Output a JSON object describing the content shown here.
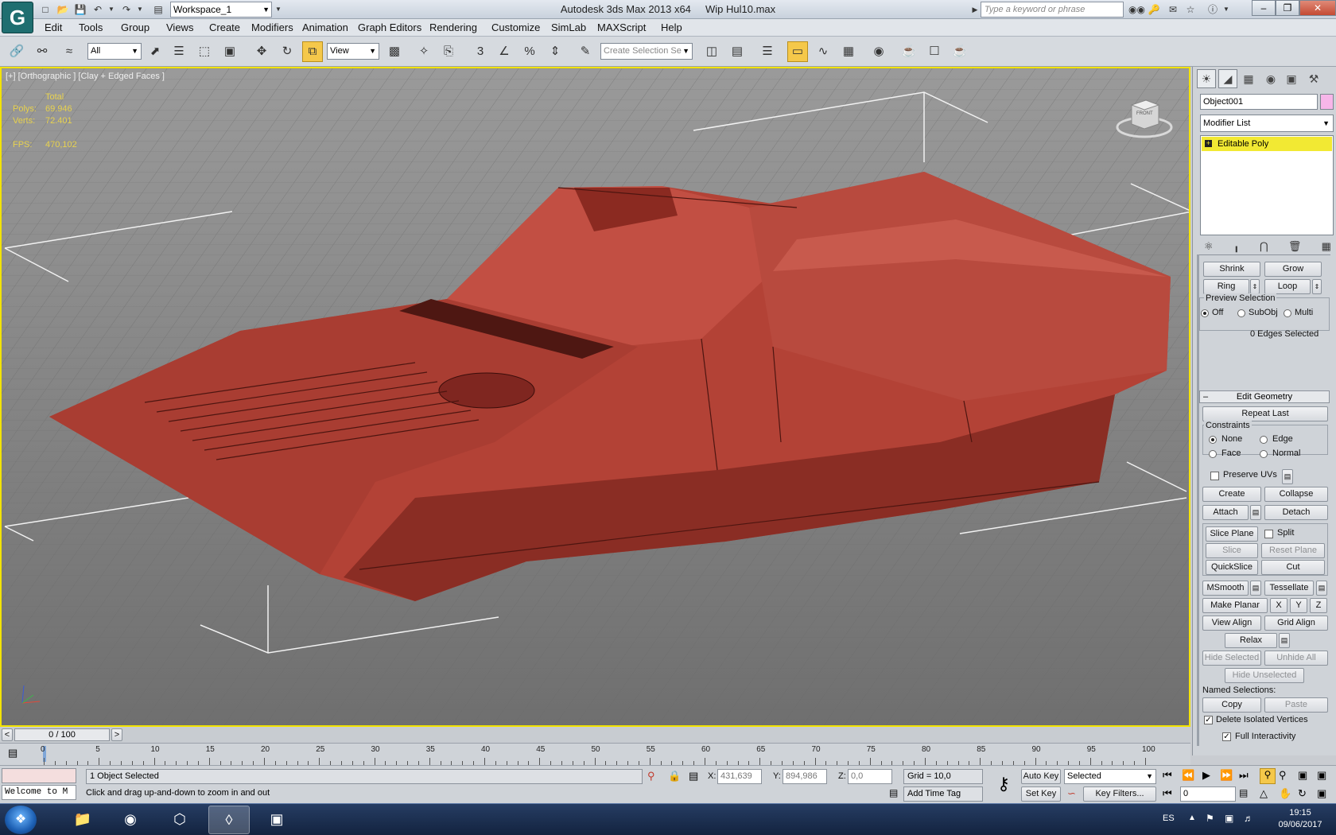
{
  "app": {
    "logo_glyph": "G",
    "workspace": "Workspace_1",
    "title": "Autodesk 3ds Max  2013 x64",
    "file": "Wip Hul10.max",
    "search_placeholder": "Type a keyword or phrase"
  },
  "menu": [
    "Edit",
    "Tools",
    "Group",
    "Views",
    "Create",
    "Modifiers",
    "Animation",
    "Graph Editors",
    "Rendering",
    "Customize",
    "SimLab",
    "MAXScript",
    "Help"
  ],
  "toolbar": {
    "filter": "All",
    "ref_coord": "View",
    "selection_set_placeholder": "Create Selection Se"
  },
  "viewport": {
    "label": "[+] [Orthographic ] [Clay + Edged Faces ]",
    "stats": {
      "total_label": "Total",
      "polys_label": "Polys:",
      "polys": "69.946",
      "verts_label": "Verts:",
      "verts": "72.401",
      "fps_label": "FPS:",
      "fps": "470,102"
    },
    "viewcube_front": "FRONT"
  },
  "command_panel": {
    "object_name": "Object001",
    "object_color": "#f7b6e9",
    "modifier_list": "Modifier List",
    "stack_item": "Editable Poly",
    "selection": {
      "shrink": "Shrink",
      "grow": "Grow",
      "ring": "Ring",
      "loop": "Loop",
      "preview_title": "Preview Selection",
      "preview_off": "Off",
      "preview_subobj": "SubObj",
      "preview_multi": "Multi",
      "edges_selected": "0 Edges Selected"
    },
    "edit_geometry": {
      "title": "Edit Geometry",
      "repeat_last": "Repeat Last",
      "constraints": "Constraints",
      "none": "None",
      "edge": "Edge",
      "face": "Face",
      "normal": "Normal",
      "preserve_uvs": "Preserve UVs",
      "create": "Create",
      "collapse": "Collapse",
      "attach": "Attach",
      "detach": "Detach",
      "slice_plane": "Slice Plane",
      "split": "Split",
      "slice": "Slice",
      "reset_plane": "Reset Plane",
      "quickslice": "QuickSlice",
      "cut": "Cut",
      "msmooth": "MSmooth",
      "tessellate": "Tessellate",
      "make_planar": "Make Planar",
      "x": "X",
      "y": "Y",
      "z": "Z",
      "view_align": "View Align",
      "grid_align": "Grid Align",
      "relax": "Relax",
      "hide_selected": "Hide Selected",
      "unhide_all": "Unhide All",
      "hide_unselected": "Hide Unselected",
      "named_selections": "Named Selections:",
      "copy": "Copy",
      "paste": "Paste",
      "delete_isolated": "Delete Isolated Vertices",
      "full_interactivity": "Full Interactivity"
    }
  },
  "timeline": {
    "frame_display": "0 / 100",
    "prev": "<",
    "next": ">",
    "ticks": [
      "0",
      "5",
      "10",
      "15",
      "20",
      "25",
      "30",
      "35",
      "40",
      "45",
      "50",
      "55",
      "60",
      "65",
      "70",
      "75",
      "80",
      "85",
      "90",
      "95",
      "100"
    ]
  },
  "status": {
    "listener": "Welcome to M",
    "selection": "1 Object Selected",
    "prompt": "Click and drag up-and-down to zoom in and out",
    "x_label": "X:",
    "x": "431,639",
    "y_label": "Y:",
    "y": "894,986",
    "z_label": "Z:",
    "z": "0,0",
    "grid": "Grid = 10,0",
    "add_time_tag": "Add Time Tag",
    "auto_key": "Auto Key",
    "set_key": "Set Key",
    "key_mode": "Selected",
    "key_filters": "Key Filters...",
    "current_frame": "0"
  },
  "taskbar": {
    "lang": "ES",
    "time": "19:15",
    "date": "09/06/2017"
  }
}
